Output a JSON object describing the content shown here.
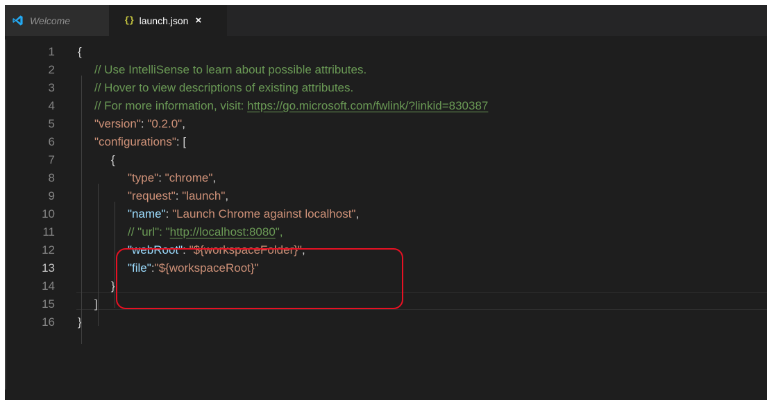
{
  "tabs": [
    {
      "label": "Welcome",
      "icon": "vscode-logo-icon",
      "active": false
    },
    {
      "label": "launch.json",
      "icon": "json-braces-icon",
      "active": true,
      "close_glyph": "×"
    }
  ],
  "editor": {
    "active_line": 13,
    "lines": [
      {
        "num": "1",
        "tokens": [
          {
            "t": "{",
            "k": "punc"
          }
        ]
      },
      {
        "num": "2",
        "tokens": [
          {
            "t": "// Use IntelliSense to learn about possible attributes.",
            "k": "com"
          }
        ]
      },
      {
        "num": "3",
        "tokens": [
          {
            "t": "// Hover to view descriptions of existing attributes.",
            "k": "com"
          }
        ]
      },
      {
        "num": "4",
        "tokens": [
          {
            "t": "// For more information, visit: ",
            "k": "com"
          },
          {
            "t": "https://go.microsoft.com/fwlink/?linkid=830387",
            "k": "link"
          }
        ]
      },
      {
        "num": "5",
        "tokens": [
          {
            "t": "\"version\"",
            "k": "str"
          },
          {
            "t": ": ",
            "k": "punc"
          },
          {
            "t": "\"0.2.0\"",
            "k": "str"
          },
          {
            "t": ",",
            "k": "punc"
          }
        ]
      },
      {
        "num": "6",
        "tokens": [
          {
            "t": "\"configurations\"",
            "k": "str"
          },
          {
            "t": ": [",
            "k": "punc"
          }
        ]
      },
      {
        "num": "7",
        "tokens": [
          {
            "t": "{",
            "k": "punc"
          }
        ]
      },
      {
        "num": "8",
        "tokens": [
          {
            "t": "\"type\"",
            "k": "str"
          },
          {
            "t": ": ",
            "k": "punc"
          },
          {
            "t": "\"chrome\"",
            "k": "str"
          },
          {
            "t": ",",
            "k": "punc"
          }
        ]
      },
      {
        "num": "9",
        "tokens": [
          {
            "t": "\"request\"",
            "k": "str"
          },
          {
            "t": ": ",
            "k": "punc"
          },
          {
            "t": "\"launch\"",
            "k": "str"
          },
          {
            "t": ",",
            "k": "punc"
          }
        ]
      },
      {
        "num": "10",
        "tokens": [
          {
            "t": "\"name\"",
            "k": "key"
          },
          {
            "t": ": ",
            "k": "punc"
          },
          {
            "t": "\"Launch Chrome against localhost\"",
            "k": "str"
          },
          {
            "t": ",",
            "k": "punc"
          }
        ]
      },
      {
        "num": "11",
        "tokens": [
          {
            "t": "// \"url\": \"",
            "k": "com"
          },
          {
            "t": "http://localhost:8080",
            "k": "link"
          },
          {
            "t": "\",",
            "k": "com"
          }
        ]
      },
      {
        "num": "12",
        "tokens": [
          {
            "t": "\"webRoot\"",
            "k": "key"
          },
          {
            "t": ": ",
            "k": "punc"
          },
          {
            "t": "\"${workspaceFolder}\"",
            "k": "str"
          },
          {
            "t": ",",
            "k": "punc"
          }
        ]
      },
      {
        "num": "13",
        "tokens": [
          {
            "t": "\"file\"",
            "k": "key"
          },
          {
            "t": ":",
            "k": "punc"
          },
          {
            "t": "\"${workspaceRoot}\"",
            "k": "str"
          }
        ]
      },
      {
        "num": "14",
        "tokens": [
          {
            "t": "}",
            "k": "punc"
          }
        ]
      },
      {
        "num": "15",
        "tokens": [
          {
            "t": "]",
            "k": "punc"
          }
        ]
      },
      {
        "num": "16",
        "tokens": [
          {
            "t": "}",
            "k": "punc"
          }
        ]
      }
    ]
  },
  "annotation": {
    "color": "#e81123",
    "marks_lines": [
      "11",
      "12",
      "13"
    ]
  },
  "colors": {
    "editor_bg": "#1e1e1e",
    "tabbar_bg": "#252526",
    "comment": "#6a9955",
    "string": "#ce9178",
    "property": "#9cdcfe",
    "punctuation": "#d4d4d4",
    "line_number": "#858585",
    "json_icon": "#cbcb41",
    "vscode_icon": "#23a9f2"
  }
}
